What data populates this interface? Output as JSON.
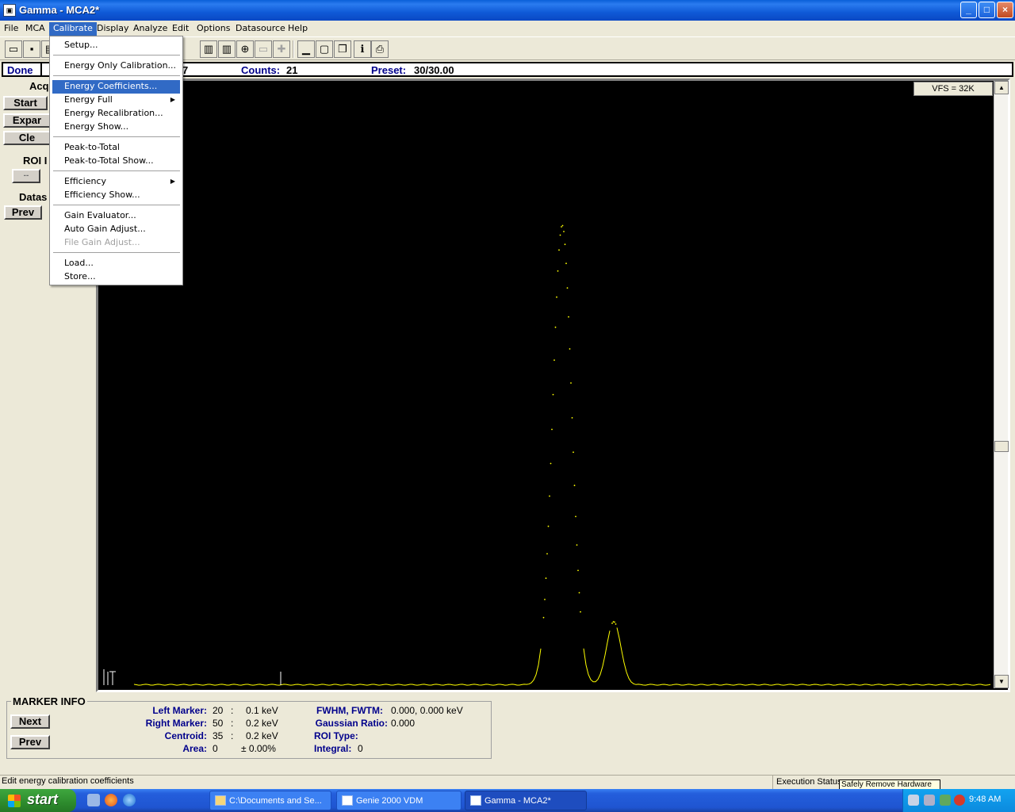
{
  "window": {
    "title": "Gamma - MCA2*",
    "app_icon": "gamma-app-icon"
  },
  "caption_buttons": {
    "minimize": "_",
    "maximize": "□",
    "close": "×"
  },
  "menubar": {
    "items": [
      "File",
      "MCA",
      "Calibrate",
      "Display",
      "Analyze",
      "Edit",
      "Options",
      "Datasource",
      "Help"
    ],
    "active": "Calibrate"
  },
  "toolbar": {
    "icons": [
      "open-folder-icon",
      "save-icon",
      "chart-icon",
      "zoom-in-icon",
      "zoom-out-icon",
      "minimize-window-icon",
      "single-window-icon",
      "cascade-window-icon",
      "info-icon",
      "print-icon"
    ]
  },
  "status": {
    "state": "Done",
    "partial_value": "7",
    "counts_label": "Counts:",
    "counts_value": "21",
    "preset_label": "Preset:",
    "preset_value": "30/30.00"
  },
  "left_panel": {
    "acq_label": "Acqu",
    "start_button": "Start",
    "expand_button": "Expar",
    "clear_button": "Cle",
    "roi_label": "ROI I",
    "roi_button": "--",
    "datasource_label": "Datas",
    "prev_button": "Prev"
  },
  "spectrum": {
    "vfs": "VFS = 32K",
    "trace_color": "#ffff00",
    "background": "#000000"
  },
  "marker_info": {
    "title": "MARKER INFO",
    "next_button": "Next",
    "prev_button": "Prev",
    "left_marker_label": "Left Marker:",
    "left_marker_channel": "20",
    "left_marker_energy": "0.1 keV",
    "right_marker_label": "Right Marker:",
    "right_marker_channel": "50",
    "right_marker_energy": "0.2 keV",
    "centroid_label": "Centroid:",
    "centroid_channel": "35",
    "centroid_energy": "0.2 keV",
    "area_label": "Area:",
    "area_value": "0",
    "area_error": "± 0.00%",
    "fwhm_label": "FWHM, FWTM:",
    "fwhm_value": "0.000, 0.000 keV",
    "gaussian_label": "Gaussian Ratio:",
    "gaussian_value": "0.000",
    "roi_type_label": "ROI Type:",
    "roi_type_value": "",
    "integral_label": "Integral:",
    "integral_value": "0",
    "colon": ":"
  },
  "statusbar": {
    "message": "Edit energy calibration coefficients",
    "execution": "Execution Status",
    "tooltip": "Safely Remove Hardware"
  },
  "calibrate_menu": {
    "items": [
      {
        "label": "Setup...",
        "type": "item"
      },
      {
        "type": "separator"
      },
      {
        "label": "Energy Only Calibration...",
        "type": "item"
      },
      {
        "type": "separator"
      },
      {
        "label": "Energy Coefficients...",
        "type": "item",
        "highlighted": true
      },
      {
        "label": "Energy Full",
        "type": "submenu"
      },
      {
        "label": "Energy Recalibration...",
        "type": "item"
      },
      {
        "label": "Energy Show...",
        "type": "item"
      },
      {
        "type": "separator"
      },
      {
        "label": "Peak-to-Total",
        "type": "item"
      },
      {
        "label": "Peak-to-Total Show...",
        "type": "item"
      },
      {
        "type": "separator"
      },
      {
        "label": "Efficiency",
        "type": "submenu"
      },
      {
        "label": "Efficiency Show...",
        "type": "item"
      },
      {
        "type": "separator"
      },
      {
        "label": "Gain Evaluator...",
        "type": "item"
      },
      {
        "label": "Auto Gain Adjust...",
        "type": "item"
      },
      {
        "label": "File Gain Adjust...",
        "type": "item",
        "disabled": true
      },
      {
        "type": "separator"
      },
      {
        "label": "Load...",
        "type": "item"
      },
      {
        "label": "Store...",
        "type": "item"
      }
    ]
  },
  "taskbar": {
    "start": "start",
    "tasks": [
      {
        "label": "C:\\Documents and Se...",
        "icon": "folder-icon",
        "active": false
      },
      {
        "label": "Genie 2000 VDM",
        "icon": "window-icon",
        "active": false
      },
      {
        "label": "Gamma - MCA2*",
        "icon": "gamma-app-icon",
        "active": true
      }
    ],
    "clock": "9:48 AM"
  }
}
